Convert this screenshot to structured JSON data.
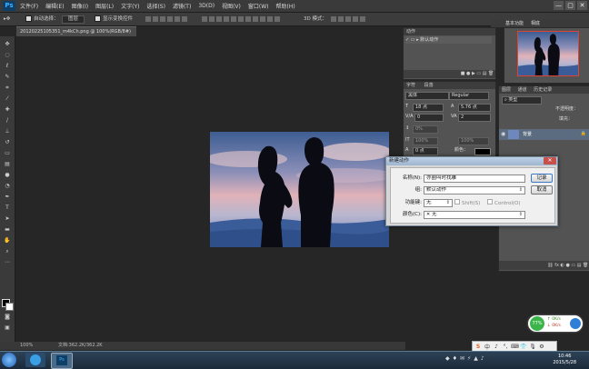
{
  "app": {
    "logo": "Ps"
  },
  "menu": [
    "文件(F)",
    "编辑(E)",
    "图像(I)",
    "图层(L)",
    "文字(Y)",
    "选择(S)",
    "滤镜(T)",
    "3D(D)",
    "视图(V)",
    "窗口(W)",
    "帮助(H)"
  ],
  "window_controls": [
    "—",
    "▢",
    "✕"
  ],
  "options_bar": {
    "auto_select_label": "自动选择：",
    "auto_select_value": "图层",
    "show_transform_label": "显示变换控件",
    "mode_3d_label": "3D 模式："
  },
  "document_tab": "20120225105351_m4kCh.png @ 100%(RGB/8#)",
  "status": {
    "zoom": "100%",
    "doc_info": "文档:362.2K/362.2K"
  },
  "actions_panel": {
    "tabs": [
      "动作"
    ],
    "tab_right": [
      "基本功能",
      "相底"
    ],
    "item": "默认动作"
  },
  "char_panel": {
    "tabs": [
      "字符",
      "段落"
    ],
    "font_family": "黑体",
    "font_style": "Regular",
    "font_size": "18 点",
    "leading": "5.76 点",
    "tracking": "0",
    "kerning": "2",
    "scale_v": "0%",
    "scale_h": "100%",
    "baseline": "0 点",
    "color_label": "颜色："
  },
  "layers_panel": {
    "tabs": [
      "图层",
      "通道",
      "历史记录"
    ],
    "opacity_label": "不透明度：",
    "fill_label": "填充：",
    "layer_name": "背景"
  },
  "dialog": {
    "title": "新建动作",
    "name_label": "名称(N):",
    "name_value": "亦圈叫时找雕",
    "set_label": "组:",
    "set_value": "默认动作",
    "fkey_label": "功能键:",
    "fkey_value": "无",
    "shift_label": "Shift(S)",
    "ctrl_label": "Control(O)",
    "color_label": "颜色(C):",
    "color_value": "无",
    "record_label": "记录",
    "cancel_label": "取消"
  },
  "net_widget": {
    "percent": "77%",
    "up": "0K/s",
    "down": "0K/s"
  },
  "ime": [
    "S",
    "中",
    "♪",
    "°,",
    "⌨",
    "👕",
    "🎙",
    "⚙"
  ],
  "clock": {
    "time": "10:46",
    "date": "2015/5/28"
  },
  "colors": {
    "accent": "#0f3f66",
    "ps_blue": "#3fb0ff",
    "panel": "#535353",
    "background": "#262626"
  }
}
